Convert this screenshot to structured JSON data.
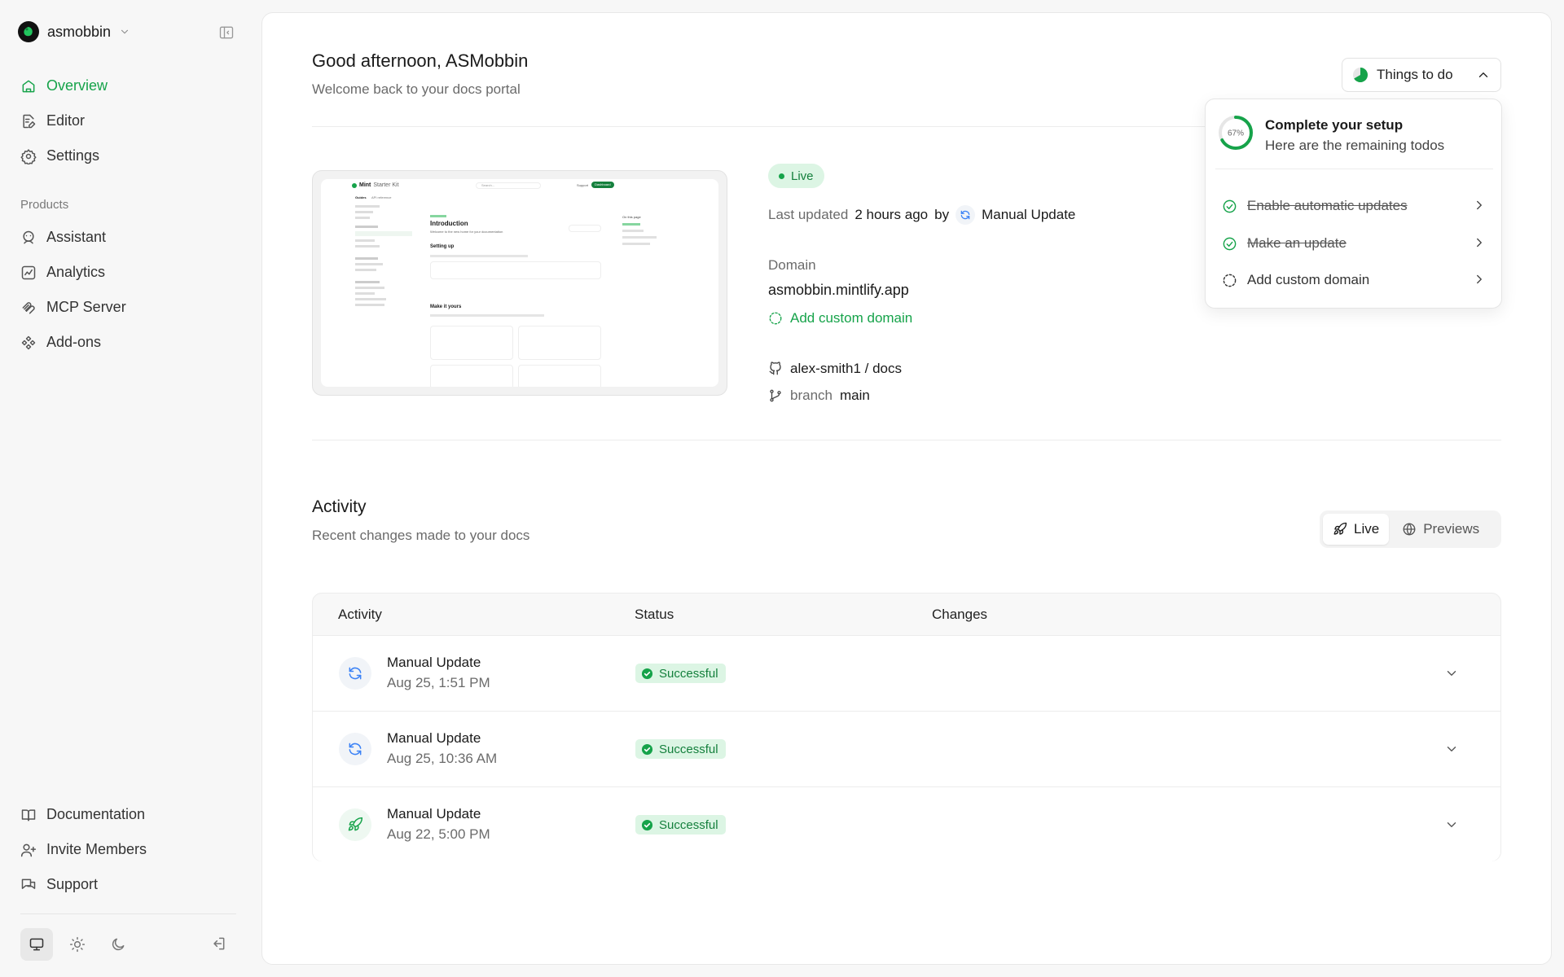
{
  "sidebar": {
    "org_name": "asmobbin",
    "nav": [
      {
        "label": "Overview",
        "icon": "home-icon",
        "active": true
      },
      {
        "label": "Editor",
        "icon": "edit-icon"
      },
      {
        "label": "Settings",
        "icon": "gear-icon"
      }
    ],
    "products_label": "Products",
    "products": [
      {
        "label": "Assistant",
        "icon": "assistant-icon"
      },
      {
        "label": "Analytics",
        "icon": "chart-icon"
      },
      {
        "label": "MCP Server",
        "icon": "mcp-icon"
      },
      {
        "label": "Add-ons",
        "icon": "addons-icon"
      }
    ],
    "footer": [
      {
        "label": "Documentation",
        "icon": "book-icon"
      },
      {
        "label": "Invite Members",
        "icon": "users-icon"
      },
      {
        "label": "Support",
        "icon": "support-icon"
      }
    ],
    "theme_active": "system"
  },
  "header": {
    "greeting": "Good afternoon, ASMobbin",
    "subtitle": "Welcome back to your docs portal",
    "todo_button": "Things to do"
  },
  "todo_popover": {
    "progress_label": "67%",
    "progress": 0.67,
    "title": "Complete your setup",
    "subtitle": "Here are the remaining todos",
    "items": [
      {
        "label": "Enable automatic updates",
        "done": true
      },
      {
        "label": "Make an update",
        "done": true
      },
      {
        "label": "Add custom domain",
        "done": false
      }
    ]
  },
  "deployment": {
    "status": "Live",
    "last_updated_label": "Last updated",
    "last_updated_time": "2 hours ago",
    "by_label": "by",
    "updated_by": "Manual Update",
    "domain_label": "Domain",
    "domain": "asmobbin.mintlify.app",
    "add_domain": "Add custom domain",
    "repo": "alex-smith1 / docs",
    "branch_label": "branch",
    "branch": "main"
  },
  "preview_thumb": {
    "brand": "Mint",
    "kit": "Starter Kit",
    "search": "Search...",
    "support": "Support",
    "dashboard": "Dashboard",
    "tab1": "Guides",
    "tab2": "API reference",
    "doc_title": "Introduction",
    "doc_sub": "Welcome to the new home for your documentation",
    "section1": "Setting up",
    "section2": "Make it yours",
    "on_this_page": "On this page"
  },
  "activity": {
    "title": "Activity",
    "subtitle": "Recent changes made to your docs",
    "tabs": [
      "Live",
      "Previews"
    ],
    "columns": [
      "Activity",
      "Status",
      "Changes"
    ],
    "rows": [
      {
        "name": "Manual Update",
        "date": "Aug 25, 1:51 PM",
        "status": "Successful",
        "icon": "refresh-icon"
      },
      {
        "name": "Manual Update",
        "date": "Aug 25, 10:36 AM",
        "status": "Successful",
        "icon": "refresh-icon"
      },
      {
        "name": "Manual Update",
        "date": "Aug 22, 5:00 PM",
        "status": "Successful",
        "icon": "rocket-icon"
      }
    ]
  },
  "colors": {
    "accent": "#16a34a",
    "accent_bg": "#dcf5e4",
    "refresh_blue": "#3b82f6"
  }
}
